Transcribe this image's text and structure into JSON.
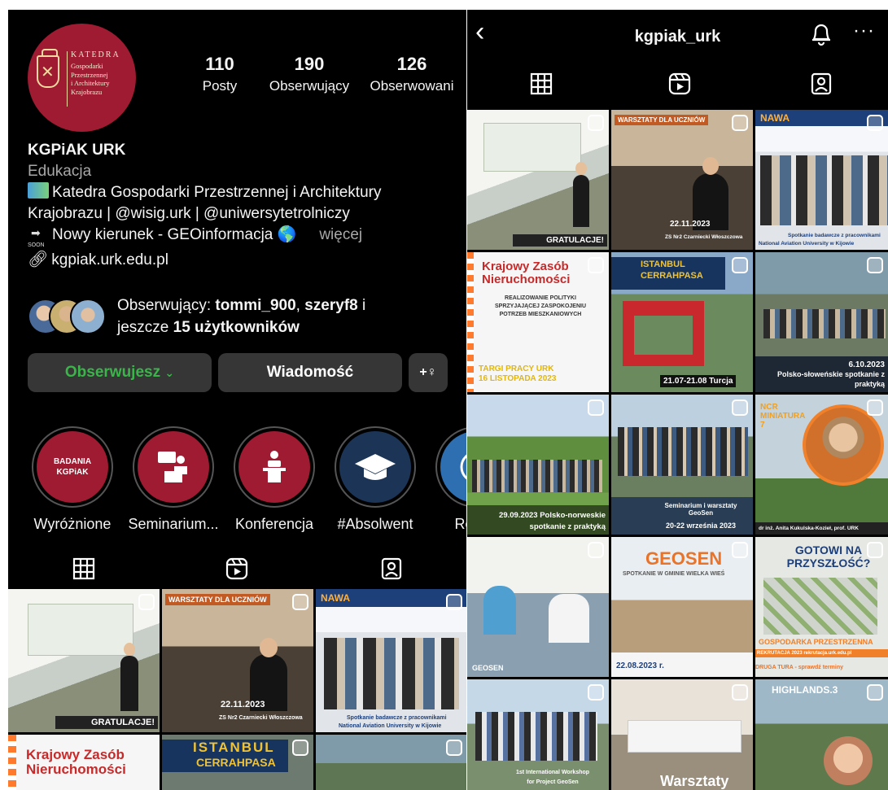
{
  "left": {
    "avatar": {
      "title": "KATEDRA",
      "lines": [
        "Gospodarki",
        "Przestrzennej",
        "i Architektury",
        "Krajobrazu"
      ]
    },
    "stats": [
      {
        "num": "110",
        "label": "Posty"
      },
      {
        "num": "190",
        "label": "Obserwujący"
      },
      {
        "num": "126",
        "label": "Obserwowani"
      }
    ],
    "bio": {
      "name": "KGPiAK URK",
      "category": "Edukacja",
      "line1": "Katedra Gospodarki Przestrzennej i Architektury",
      "line2": "Krajobrazu | @wisig.urk | @uniwersytetrolniczy",
      "line3": "Nowy kierunek - GEOinformacja 🌎",
      "more": "więcej",
      "link": "kgpiak.urk.edu.pl"
    },
    "mutual": {
      "prefix": "Obserwujący: ",
      "user1": "tommi_900",
      "sep": ", ",
      "user2": "szeryf8",
      "mid": " i",
      "line2_prefix": "jeszcze ",
      "line2_bold": "15 użytkowników"
    },
    "buttons": {
      "follow": "Obserwujesz",
      "follow_chevron": "⌄",
      "message": "Wiadomość",
      "add_user_icon": "+♀"
    },
    "highlights": [
      {
        "label": "Wyróżnione",
        "inner": "BADANIA\nKGPiAK"
      },
      {
        "label": "Seminarium...",
        "icon": "presenter-icon"
      },
      {
        "label": "Konferencja",
        "icon": "podium-icon"
      },
      {
        "label": "#Absolwent",
        "icon": "graduation-cap-icon"
      },
      {
        "label": "Rekrut",
        "icon": "user-circle-icon"
      }
    ],
    "tiles": [
      {
        "caption": "GRATULACJE!"
      },
      {
        "caption_top": "WARSZTATY DLA UCZNIÓW",
        "caption": "22.11.2023",
        "sub": "ZS Nr2 Czarniecki Włoszczowa"
      },
      {
        "caption_top": "NAWA",
        "caption": "Spotkanie badawcze z pracownikami",
        "sub": "National Aviation University w Kijowie"
      },
      {
        "caption": "Krajowy Zasób Nieruchomości"
      },
      {
        "caption": "ISTANBUL",
        "sub": "CERRAHPASA"
      },
      {
        "caption": ""
      }
    ]
  },
  "right": {
    "header": {
      "back": "‹",
      "title": "kgpiak_urk",
      "more": "···"
    },
    "tiles": [
      {
        "caption": "GRATULACJE!"
      },
      {
        "caption_top": "WARSZTATY DLA UCZNIÓW",
        "caption": "22.11.2023",
        "sub": "ZS Nr2 Czarniecki Włoszczowa"
      },
      {
        "caption_top": "NAWA",
        "caption": "Spotkanie badawcze z pracownikami",
        "sub": "National Aviation University w Kijowie"
      },
      {
        "caption": "Krajowy Zasób Nieruchomości",
        "sub": "REALIZOWANIE POLITYKI SPRZYJAJĄCEJ ZASPOKOJENIU POTRZEB MIESZKANIOWYCH",
        "extra": "TARGI PRACY URK 16 LISTOPADA 2023"
      },
      {
        "caption_top": "ISTANBUL CERRAHPASA",
        "caption": "21.07-21.08 Turcja"
      },
      {
        "caption": "6.10.2023",
        "sub": "Polsko-słoweńskie spotkanie z praktyką"
      },
      {
        "caption": "29.09.2023  Polsko-norweskie",
        "sub": "spotkanie z praktyką"
      },
      {
        "caption": "Seminarium i warsztaty GeoSen",
        "sub": "20-22 września 2023"
      },
      {
        "caption_top": "NCR MINIATURA 7",
        "caption": "dr inż. Anita Kukulska-Kozieł, prof. URK"
      },
      {
        "caption": "GEOSEN"
      },
      {
        "caption_top": "GEOSEN",
        "caption": "SPOTKANIE W GMINIE WIELKA WIEŚ",
        "sub": "22.08.2023 r."
      },
      {
        "caption_top": "GOTOWI NA PRZYSZŁOŚĆ?",
        "caption": "GOSPODARKA PRZESTRZENNA",
        "sub": "REKRUTACJA 2023  rekrutacja.urk.edu.pl",
        "extra": "DRUGA TURA - sprawdź terminy"
      },
      {
        "caption": "1st International Workshop",
        "sub": "for Project GeoSen"
      },
      {
        "caption": "Warsztaty"
      },
      {
        "caption_top": "HIGHLANDS.3",
        "caption": ""
      }
    ]
  },
  "colors": {
    "brand_red": "#9e1b32",
    "follow_green": "#3bb54a",
    "button_gray": "#363636"
  }
}
